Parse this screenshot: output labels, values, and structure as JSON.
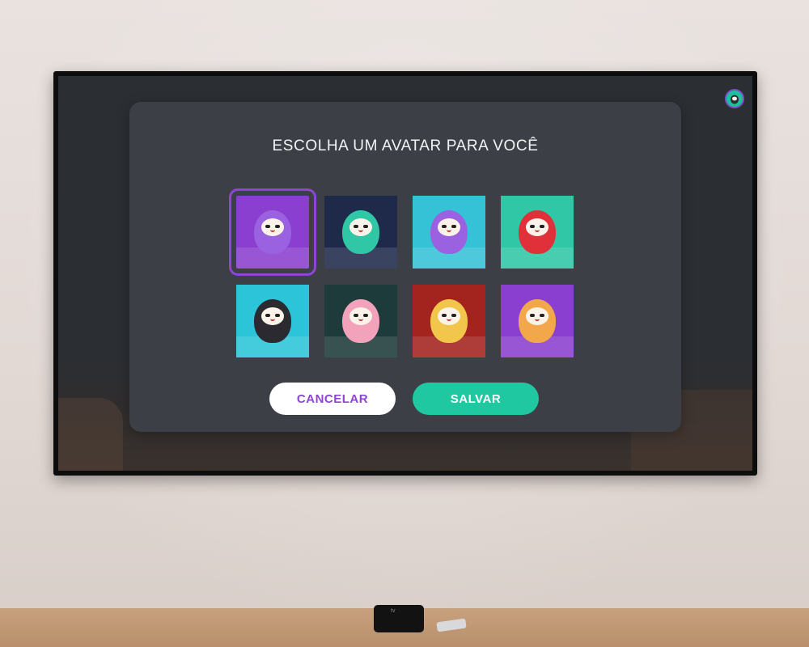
{
  "screen": {
    "title": "ESCOLHA UM AVATAR PARA VOCÊ",
    "profile_icon": "profile-avatar-icon"
  },
  "avatars": [
    {
      "name": "sushi-daruma",
      "selected": true,
      "bg": "#8a3fd0",
      "face": "#9a62e0"
    },
    {
      "name": "lantern-daruma",
      "selected": false,
      "bg": "#1f2a4a",
      "face": "#2fc7a6"
    },
    {
      "name": "cat-daruma",
      "selected": false,
      "bg": "#35c2d6",
      "face": "#9a62e0"
    },
    {
      "name": "mountain-daruma",
      "selected": false,
      "bg": "#2fc7a6",
      "face": "#e0303a"
    },
    {
      "name": "ninja-daruma",
      "selected": false,
      "bg": "#2bc4d8",
      "face": "#2a2a30"
    },
    {
      "name": "sakura-daruma",
      "selected": false,
      "bg": "#1d3b3a",
      "face": "#f2a2bb"
    },
    {
      "name": "dango-daruma",
      "selected": false,
      "bg": "#a3231f",
      "face": "#f2c64a"
    },
    {
      "name": "fan-daruma",
      "selected": false,
      "bg": "#8a3fd0",
      "face": "#f2a84a"
    }
  ],
  "buttons": {
    "cancel": "CANCELAR",
    "save": "SALVAR"
  },
  "device": {
    "label": "tv"
  },
  "colors": {
    "accent_purple": "#8e45d6",
    "accent_green": "#1fc8a0",
    "modal_bg": "#3c4046",
    "screen_bg": "#2b2e33"
  }
}
